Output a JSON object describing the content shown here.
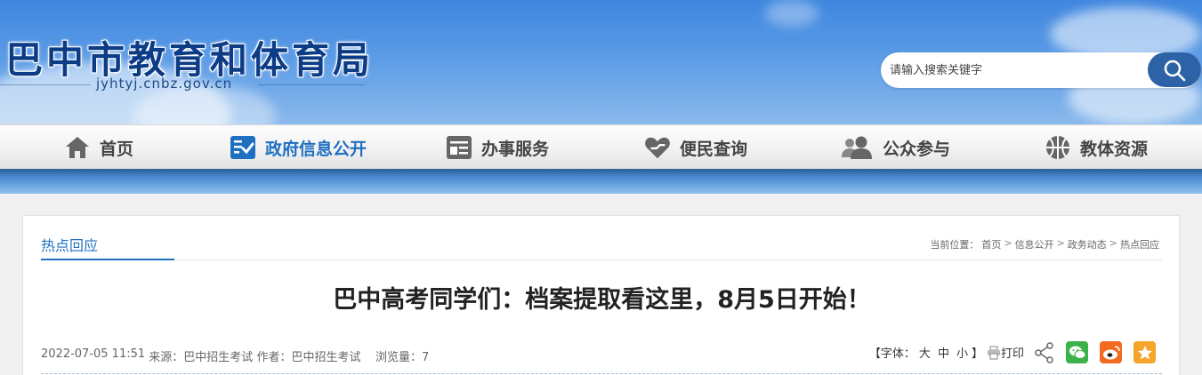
{
  "header": {
    "site_title": "巴中市教育和体育局",
    "site_domain": "jyhtyj.cnbz.gov.cn",
    "search_placeholder": "请输入搜索关键字"
  },
  "nav": {
    "items": [
      {
        "label": "首页",
        "icon": "home-icon"
      },
      {
        "label": "政府信息公开",
        "icon": "checklist-icon",
        "active": true
      },
      {
        "label": "办事服务",
        "icon": "service-card-icon"
      },
      {
        "label": "便民查询",
        "icon": "heart-hand-icon"
      },
      {
        "label": "公众参与",
        "icon": "people-icon"
      },
      {
        "label": "教体资源",
        "icon": "ball-icon"
      }
    ]
  },
  "section": {
    "title": "热点回应"
  },
  "breadcrumb": {
    "prefix": "当前位置：",
    "items": [
      "首页",
      "信息公开",
      "政务动态",
      "热点回应"
    ],
    "separator": ">"
  },
  "article": {
    "title": "巴中高考同学们：档案提取看这里，8月5日开始！",
    "date": "2022-07-05 11:51",
    "source": "来源：巴中招生考试",
    "author": "作者：巴中招生考试",
    "views": "浏览量：7"
  },
  "tools": {
    "font_label": "【字体：",
    "font_large": "大",
    "font_medium": "中",
    "font_small": "小",
    "font_close": "】",
    "print_label": "打印"
  },
  "colors": {
    "accent": "#1f6fc0",
    "wechat": "#3bb34a",
    "weibo": "#f26b21",
    "favorite": "#f4a52a"
  }
}
